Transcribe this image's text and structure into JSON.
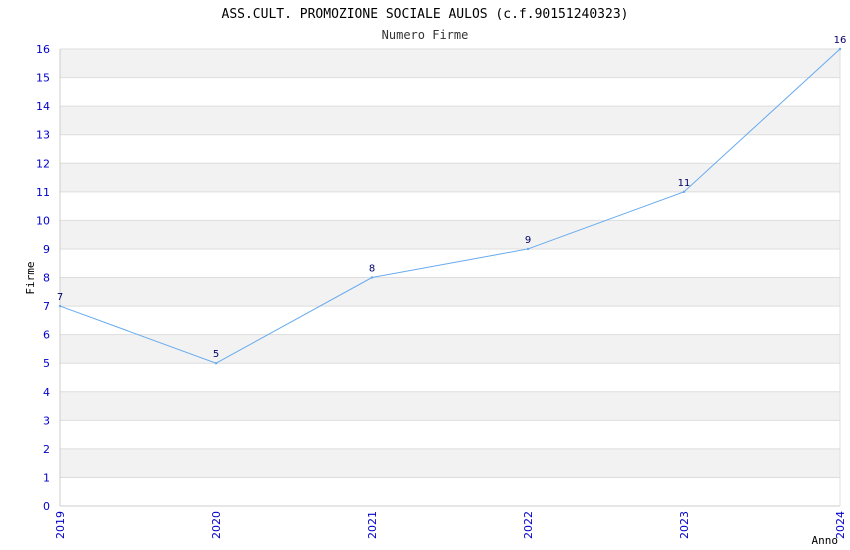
{
  "chart_data": {
    "type": "line",
    "title": "ASS.CULT. PROMOZIONE SOCIALE AULOS (c.f.90151240323)",
    "subtitle": "Numero Firme",
    "xlabel": "Anno",
    "ylabel": "Firme",
    "categories": [
      "2019",
      "2020",
      "2021",
      "2022",
      "2023",
      "2024"
    ],
    "series": [
      {
        "values": [
          7,
          5,
          8,
          9,
          11,
          16
        ],
        "data_labels": [
          "7",
          "5",
          "8",
          "9",
          "11",
          "16"
        ]
      }
    ],
    "ylim": [
      0,
      16
    ],
    "yticks": [
      "0",
      "1",
      "2",
      "3",
      "4",
      "5",
      "6",
      "7",
      "8",
      "9",
      "10",
      "11",
      "12",
      "13",
      "14",
      "15",
      "16"
    ],
    "grid": true,
    "legend": "none",
    "colors": {
      "line": "#66aaee",
      "band": "#f2f2f2",
      "grid": "#dddddd",
      "tick_text": "#0000cc",
      "data_label": "#000066"
    }
  }
}
